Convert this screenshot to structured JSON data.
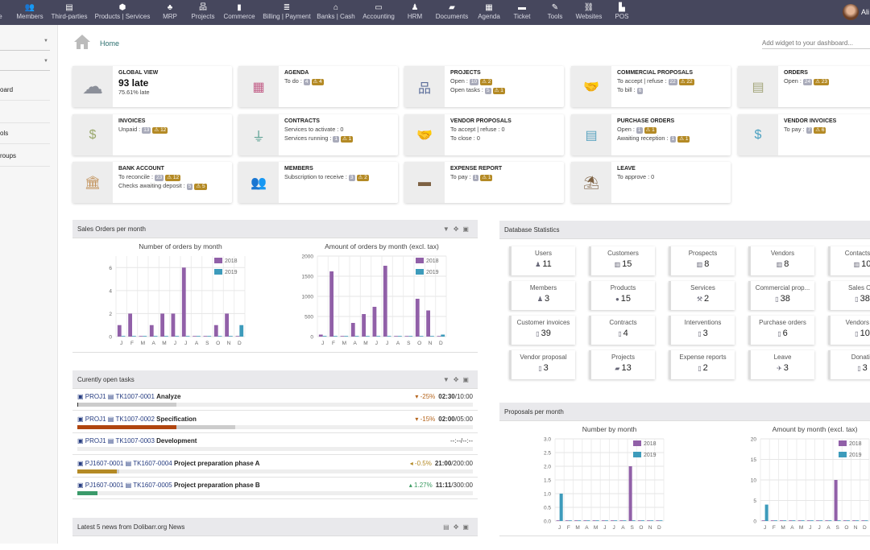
{
  "topbar": {
    "items": [
      {
        "label": "Home",
        "icon": "⌂"
      },
      {
        "label": "Members",
        "icon": "👥"
      },
      {
        "label": "Third-parties",
        "icon": "▤"
      },
      {
        "label": "Products | Services",
        "icon": "⬢"
      },
      {
        "label": "MRP",
        "icon": "♣"
      },
      {
        "label": "Projects",
        "icon": "品"
      },
      {
        "label": "Commerce",
        "icon": "▮"
      },
      {
        "label": "Billing | Payment",
        "icon": "≣"
      },
      {
        "label": "Banks | Cash",
        "icon": "⌂"
      },
      {
        "label": "Accounting",
        "icon": "▭"
      },
      {
        "label": "HRM",
        "icon": "♟"
      },
      {
        "label": "Documents",
        "icon": "▰"
      },
      {
        "label": "Agenda",
        "icon": "▦"
      },
      {
        "label": "Ticket",
        "icon": "▬"
      },
      {
        "label": "Tools",
        "icon": "✎"
      },
      {
        "label": "Websites",
        "icon": "⛓"
      },
      {
        "label": "POS",
        "icon": "▙"
      }
    ],
    "user": "Ali"
  },
  "sidebar": {
    "items": [
      "oard",
      "ols",
      "roups"
    ]
  },
  "breadcrumb": "Home",
  "add_widget_placeholder": "Add widget to your dashboard...",
  "colors": {
    "topbar": "#46475d",
    "badge": "#a9abba",
    "warning": "#b48a25",
    "series_2018": "#9160a8",
    "series_2019": "#3d9bbb"
  },
  "boxes": [
    {
      "title": "GLOBAL VIEW",
      "icon": "cloud-rain-icon",
      "glyph": "☁",
      "color": "#8b8f99",
      "big": "93 late",
      "sub": "75.61% late",
      "lines": []
    },
    {
      "title": "AGENDA",
      "icon": "calendar-icon",
      "glyph": "▦",
      "color": "#c25e87",
      "lines": [
        {
          "label": "To do :",
          "count": "4",
          "warn": "4"
        }
      ]
    },
    {
      "title": "PROJECTS",
      "icon": "sitemap-icon",
      "glyph": "品",
      "color": "#5b6d9a",
      "lines": [
        {
          "label": "Open :",
          "count": "10",
          "warn": "2"
        },
        {
          "label": "Open tasks :",
          "count": "5",
          "warn": "1"
        }
      ]
    },
    {
      "title": "COMMERCIAL PROPOSALS",
      "icon": "handshake-icon",
      "glyph": "🤝",
      "color": "#8aa3a0",
      "lines": [
        {
          "label": "To accept | refuse :",
          "count": "22",
          "warn": "22"
        },
        {
          "label": "To bill :",
          "count": "6"
        }
      ]
    },
    {
      "title": "ORDERS",
      "icon": "file-order-icon",
      "glyph": "▤",
      "color": "#a3a57a",
      "lines": [
        {
          "label": "Open :",
          "count": "24",
          "warn": "23"
        }
      ]
    },
    {
      "title": "INVOICES",
      "icon": "invoice-icon",
      "glyph": "$",
      "color": "#9aa86c",
      "lines": [
        {
          "label": "Unpaid :",
          "count": "13",
          "warn": "12"
        }
      ]
    },
    {
      "title": "CONTRACTS",
      "icon": "plug-icon",
      "glyph": "⏚",
      "color": "#469686",
      "lines": [
        {
          "label": "Services to activate : 0"
        },
        {
          "label": "Services running :",
          "count": "1",
          "warn": "1"
        }
      ]
    },
    {
      "title": "VENDOR PROPOSALS",
      "icon": "handshake-icon",
      "glyph": "🤝",
      "color": "#4a9fba",
      "lines": [
        {
          "label": "To accept | refuse : 0"
        },
        {
          "label": "To close : 0"
        }
      ]
    },
    {
      "title": "PURCHASE ORDERS",
      "icon": "file-purchase-icon",
      "glyph": "▤",
      "color": "#5aa3c0",
      "lines": [
        {
          "label": "Open :",
          "count": "1",
          "warn": "1"
        },
        {
          "label": "Awaiting reception :",
          "count": "1",
          "warn": "1"
        }
      ]
    },
    {
      "title": "VENDOR INVOICES",
      "icon": "vendor-invoice-icon",
      "glyph": "$",
      "color": "#4aa0c0",
      "lines": [
        {
          "label": "To pay :",
          "count": "7",
          "warn": "6"
        }
      ]
    },
    {
      "title": "BANK ACCOUNT",
      "icon": "bank-icon",
      "glyph": "🏛",
      "color": "#c2925a",
      "lines": [
        {
          "label": "To reconcile :",
          "count": "23",
          "warn": "12"
        },
        {
          "label": "Checks awaiting deposit :",
          "count": "5",
          "warn": "5"
        }
      ]
    },
    {
      "title": "MEMBERS",
      "icon": "users-icon",
      "glyph": "👥",
      "color": "#6d6a60",
      "lines": [
        {
          "label": "Subscription to receive :",
          "count": "3",
          "warn": "2"
        }
      ]
    },
    {
      "title": "EXPENSE REPORT",
      "icon": "wallet-icon",
      "glyph": "▬",
      "color": "#7d6143",
      "lines": [
        {
          "label": "To pay :",
          "count": "1",
          "warn": "1"
        }
      ]
    },
    {
      "title": "LEAVE",
      "icon": "umbrella-beach-icon",
      "glyph": "⛱",
      "color": "#7d6143",
      "lines": [
        {
          "label": "To approve : 0"
        }
      ]
    }
  ],
  "sales_panel": {
    "title": "Sales Orders per month"
  },
  "tasks_panel": {
    "title": "Curently open tasks",
    "rows": [
      {
        "project": "PROJ1",
        "task": "TK1007-0001",
        "label": "Analyze",
        "delta": "▾ -25%",
        "delta_color": "#b5651d",
        "spent": "02:30",
        "planned": "/10:00",
        "time_pct": 25,
        "progress_pct": 0.3,
        "fill": "#333"
      },
      {
        "project": "PROJ1",
        "task": "TK1007-0002",
        "label": "Specification",
        "delta": "▾ -15%",
        "delta_color": "#b5651d",
        "spent": "02:00",
        "planned": "/05:00",
        "time_pct": 40,
        "progress_pct": 25,
        "fill": "#b0450f"
      },
      {
        "project": "PROJ1",
        "task": "TK1007-0003",
        "label": "Development",
        "delta": "",
        "delta_color": "#888",
        "spent": "",
        "planned": "--:--/--:--",
        "time_pct": 0,
        "progress_pct": 0,
        "fill": "#ccc"
      },
      {
        "project": "PJ1607-0001",
        "task": "TK1607-0004",
        "label": "Project preparation phase A",
        "delta": "◂ -0.5%",
        "delta_color": "#b48a25",
        "spent": "21:00",
        "planned": "/200:00",
        "time_pct": 10.5,
        "progress_pct": 10,
        "fill": "#b48a25"
      },
      {
        "project": "PJ1607-0001",
        "task": "TK1607-0005",
        "label": "Project preparation phase B",
        "delta": "▴ 1.27%",
        "delta_color": "#3a9a60",
        "spent": "11:11",
        "planned": "/300:00",
        "time_pct": 3.7,
        "progress_pct": 5,
        "fill": "#3a9a6a"
      }
    ]
  },
  "news_panel": {
    "title": "Latest 5 news from Dolibarr.org News"
  },
  "db_panel": {
    "title": "Database Statistics",
    "tiles": [
      {
        "label": "Users",
        "value": "11",
        "icon": "♟"
      },
      {
        "label": "Customers",
        "value": "15",
        "icon": "▥"
      },
      {
        "label": "Prospects",
        "value": "8",
        "icon": "▥"
      },
      {
        "label": "Vendors",
        "value": "8",
        "icon": "▥"
      },
      {
        "label": "Contacts/Ad",
        "value": "10",
        "icon": "▥"
      },
      {
        "label": "Members",
        "value": "3",
        "icon": "♟"
      },
      {
        "label": "Products",
        "value": "15",
        "icon": "●"
      },
      {
        "label": "Services",
        "value": "2",
        "icon": "⚒"
      },
      {
        "label": "Commercial prop...",
        "value": "38",
        "icon": "▯"
      },
      {
        "label": "Sales Orc",
        "value": "38",
        "icon": "▯"
      },
      {
        "label": "Customer invoices",
        "value": "39",
        "icon": "▯"
      },
      {
        "label": "Contracts",
        "value": "4",
        "icon": "▯"
      },
      {
        "label": "Interventions",
        "value": "3",
        "icon": "▯"
      },
      {
        "label": "Purchase orders",
        "value": "6",
        "icon": "▯"
      },
      {
        "label": "Vendors inv",
        "value": "10",
        "icon": "▯"
      },
      {
        "label": "Vendor proposal",
        "value": "3",
        "icon": "▯"
      },
      {
        "label": "Projects",
        "value": "13",
        "icon": "▰"
      },
      {
        "label": "Expense reports",
        "value": "2",
        "icon": "▯"
      },
      {
        "label": "Leave",
        "value": "3",
        "icon": "✈"
      },
      {
        "label": "Donatio",
        "value": "3",
        "icon": "▯"
      }
    ]
  },
  "proposals_panel": {
    "title": "Proposals per month"
  },
  "chart_data": [
    {
      "type": "bar",
      "title": "Number of orders by month",
      "categories": [
        "J",
        "F",
        "M",
        "A",
        "M",
        "J",
        "J",
        "A",
        "S",
        "O",
        "N",
        "D"
      ],
      "series": [
        {
          "name": "2018",
          "values": [
            1,
            2,
            0,
            1,
            2,
            2,
            6,
            0,
            0,
            1,
            2,
            0
          ]
        },
        {
          "name": "2019",
          "values": [
            0,
            0,
            0,
            0,
            0,
            0,
            0,
            0,
            0,
            0,
            0,
            1
          ]
        }
      ],
      "ylim": [
        0,
        7
      ],
      "yticks": [
        "0",
        "2",
        "4",
        "6"
      ],
      "grid": true,
      "legend": "top-right"
    },
    {
      "type": "bar",
      "title": "Amount of orders by month (excl. tax)",
      "categories": [
        "J",
        "F",
        "M",
        "A",
        "M",
        "J",
        "J",
        "A",
        "S",
        "O",
        "N",
        "D"
      ],
      "series": [
        {
          "name": "2018",
          "values": [
            50,
            1620,
            0,
            340,
            560,
            740,
            1760,
            0,
            0,
            940,
            650,
            0
          ]
        },
        {
          "name": "2019",
          "values": [
            0,
            0,
            0,
            0,
            0,
            0,
            0,
            0,
            0,
            0,
            0,
            50
          ]
        }
      ],
      "ylim": [
        0,
        2000
      ],
      "yticks": [
        "0",
        "500",
        "1000",
        "1500",
        "2000"
      ],
      "grid": true,
      "legend": "top-right"
    },
    {
      "type": "bar",
      "title": "Number by month",
      "categories": [
        "J",
        "F",
        "M",
        "A",
        "M",
        "J",
        "J",
        "A",
        "S",
        "O",
        "N",
        "D"
      ],
      "series": [
        {
          "name": "2018",
          "values": [
            0,
            0,
            0,
            0,
            0,
            0,
            0,
            0,
            2,
            0,
            0,
            0
          ]
        },
        {
          "name": "2019",
          "values": [
            1,
            0,
            0,
            0,
            0,
            0,
            0,
            0,
            0,
            0,
            0,
            0
          ]
        }
      ],
      "ylim": [
        0,
        3
      ],
      "yticks": [
        "0.0",
        "0.5",
        "1.0",
        "1.5",
        "2.0",
        "2.5",
        "3.0"
      ],
      "grid": true,
      "legend": "top-right"
    },
    {
      "type": "bar",
      "title": "Amount by month (excl. tax)",
      "categories": [
        "J",
        "F",
        "M",
        "A",
        "M",
        "J",
        "J",
        "A",
        "S",
        "O",
        "N",
        "D"
      ],
      "series": [
        {
          "name": "2018",
          "values": [
            0,
            0,
            0,
            0,
            0,
            0,
            0,
            0,
            10,
            0,
            0,
            0
          ]
        },
        {
          "name": "2019",
          "values": [
            4,
            0,
            0,
            0,
            0,
            0,
            0,
            0,
            0,
            0,
            0,
            0
          ]
        }
      ],
      "ylim": [
        0,
        20
      ],
      "yticks": [
        "0",
        "5",
        "10",
        "15",
        "20"
      ],
      "grid": true,
      "legend": "top-right"
    }
  ]
}
